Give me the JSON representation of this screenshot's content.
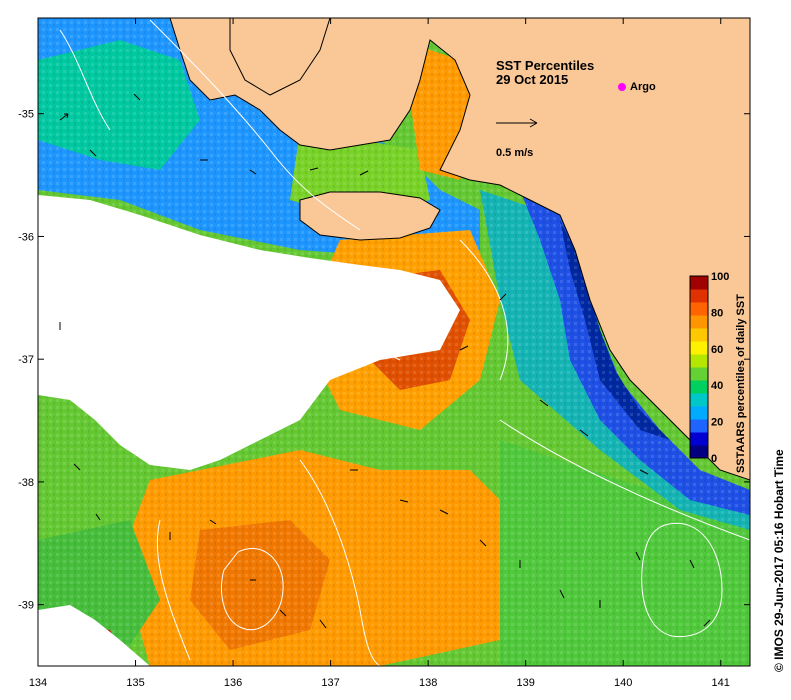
{
  "map": {
    "title": "SST Percentiles",
    "date": "29 Oct 2015",
    "scale_label": "0.5 m/s",
    "argo_label": "Argo",
    "credit": "© IMOS 29-Jun-2017 05:16 Hobart Time",
    "x_ticks": [
      "134",
      "135",
      "136",
      "137",
      "138",
      "139",
      "140",
      "141"
    ],
    "y_ticks": [
      "-35",
      "-36",
      "-37",
      "-38",
      "-39"
    ],
    "colorbar": {
      "label": "SSTAARS percentiles of daily SST",
      "ticks": [
        "0",
        "20",
        "40",
        "60",
        "80",
        "100"
      ],
      "colors": [
        "#000080",
        "#0000d0",
        "#1e64ff",
        "#00aaff",
        "#00c8c8",
        "#00d060",
        "#64d232",
        "#b4e600",
        "#fff000",
        "#ffc800",
        "#ff9600",
        "#ff6400",
        "#e03200",
        "#a00000"
      ]
    },
    "colors": {
      "land": "#fac896",
      "no_data": "#ffffff",
      "coast": "#000000",
      "contour": "#ffffff",
      "argo": "#ff00ff"
    }
  }
}
